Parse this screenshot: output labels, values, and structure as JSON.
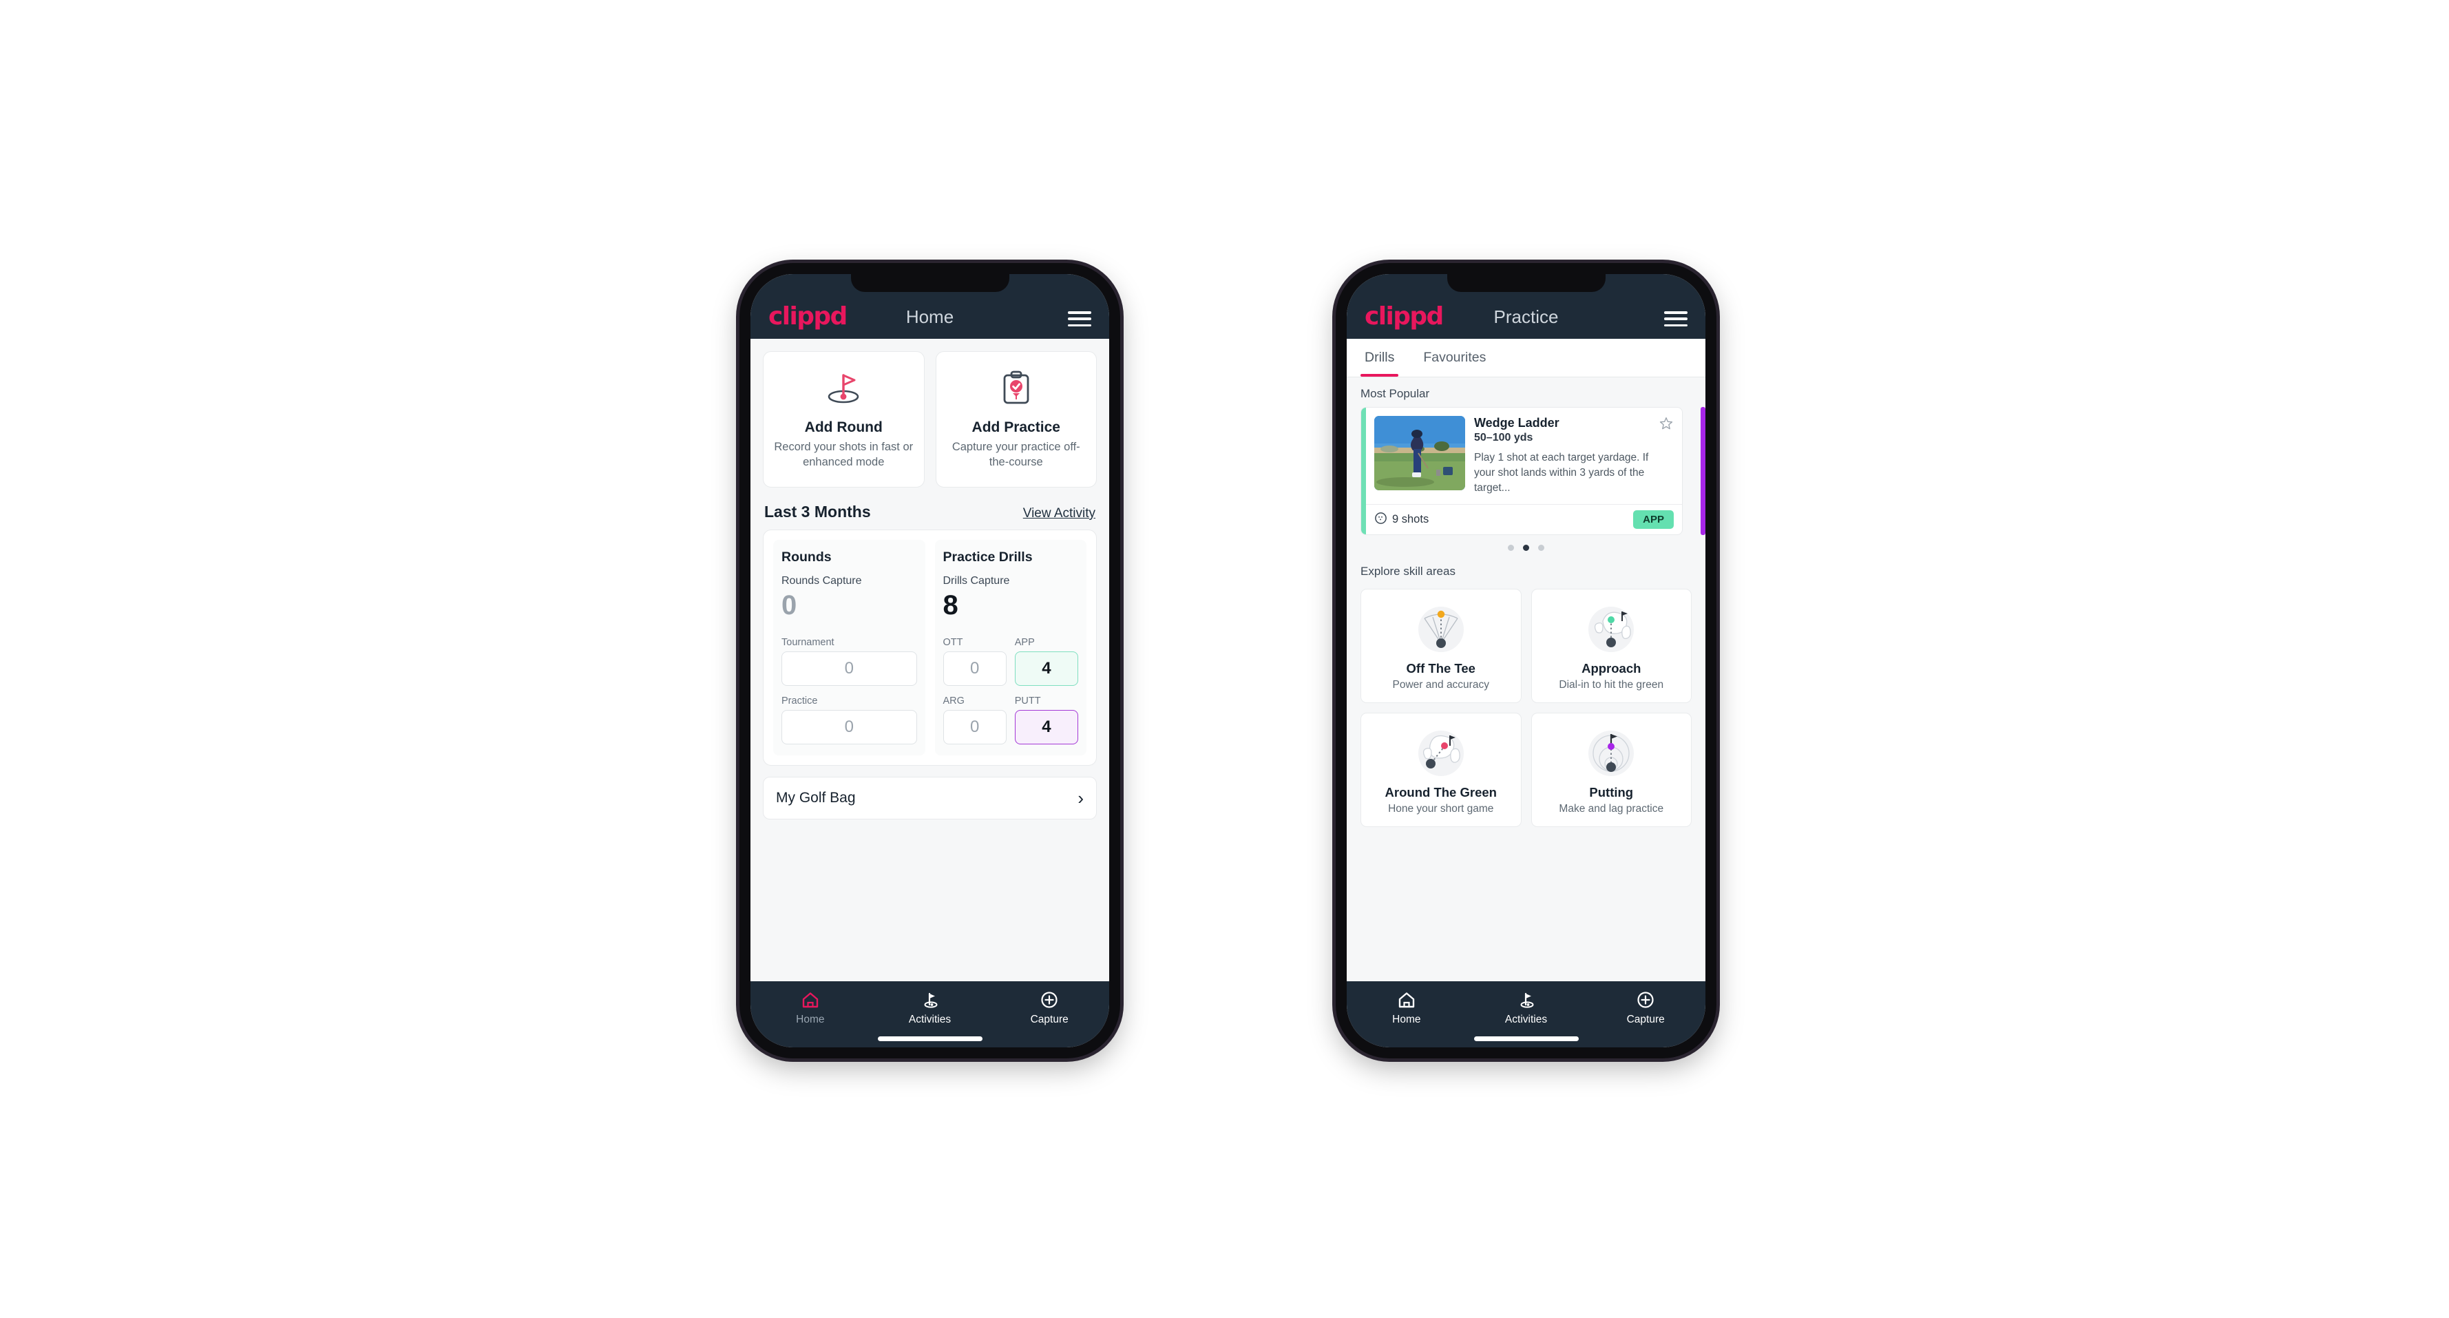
{
  "brand": "clippd",
  "home": {
    "title": "Home",
    "menu_icon": "hamburger-icon",
    "quick_actions": [
      {
        "icon": "golf-flag-hole-icon",
        "title": "Add Round",
        "subtitle": "Record your shots in fast or enhanced mode"
      },
      {
        "icon": "clipboard-check-icon",
        "title": "Add Practice",
        "subtitle": "Capture your practice off-the-course"
      }
    ],
    "section": {
      "title": "Last 3 Months",
      "link": "View Activity"
    },
    "rounds": {
      "heading": "Rounds",
      "capture_label": "Rounds Capture",
      "capture_value": "0",
      "rows": [
        {
          "label": "Tournament",
          "value": "0"
        },
        {
          "label": "Practice",
          "value": "0"
        }
      ]
    },
    "drills": {
      "heading": "Practice Drills",
      "capture_label": "Drills Capture",
      "capture_value": "8",
      "cells": [
        {
          "label": "OTT",
          "value": "0",
          "state": "plain"
        },
        {
          "label": "APP",
          "value": "4",
          "state": "app"
        },
        {
          "label": "ARG",
          "value": "0",
          "state": "plain"
        },
        {
          "label": "PUTT",
          "value": "4",
          "state": "putt"
        }
      ]
    },
    "golf_bag": {
      "label": "My Golf Bag",
      "chevron": "chevron-right-icon"
    },
    "bottom_nav": [
      {
        "icon": "home-icon",
        "label": "Home",
        "active": true
      },
      {
        "icon": "golf-flag-icon",
        "label": "Activities",
        "active": false
      },
      {
        "icon": "plus-circle-icon",
        "label": "Capture",
        "active": false
      }
    ]
  },
  "practice": {
    "title": "Practice",
    "menu_icon": "hamburger-icon",
    "tabs": [
      {
        "label": "Drills",
        "active": true
      },
      {
        "label": "Favourites",
        "active": false
      }
    ],
    "most_popular_label": "Most Popular",
    "drill": {
      "title": "Wedge Ladder",
      "yardage": "50–100 yds",
      "description": "Play 1 shot at each target yardage. If your shot lands within 3 yards of the target...",
      "shots": "9 shots",
      "shots_icon": "golf-ball-icon",
      "tag": "APP",
      "tag_color": "#64e0b0",
      "accent_color": "#6fe0b5",
      "next_accent_color": "#a726e8",
      "favourite_icon": "star-outline-icon"
    },
    "carousel_dots": [
      false,
      true,
      false
    ],
    "skill_label": "Explore skill areas",
    "skills": [
      {
        "icon": "tee-fan-icon",
        "title": "Off The Tee",
        "subtitle": "Power and accuracy",
        "dot_color": "#f2a81d"
      },
      {
        "icon": "green-target-icon",
        "title": "Approach",
        "subtitle": "Dial-in to hit the green",
        "dot_color": "#4fd8a6"
      },
      {
        "icon": "chip-green-icon",
        "title": "Around The Green",
        "subtitle": "Hone your short game",
        "dot_color": "#e8456b"
      },
      {
        "icon": "putting-rings-icon",
        "title": "Putting",
        "subtitle": "Make and lag practice",
        "dot_color": "#a726e8"
      }
    ],
    "bottom_nav": [
      {
        "icon": "home-icon",
        "label": "Home",
        "active": false
      },
      {
        "icon": "golf-flag-icon",
        "label": "Activities",
        "active": false
      },
      {
        "icon": "plus-circle-icon",
        "label": "Capture",
        "active": false
      }
    ]
  },
  "colors": {
    "brand_pink": "#e8175d",
    "navy": "#1e2b38",
    "app_green": "#64e0b0",
    "putt_purple": "#a438d6"
  }
}
